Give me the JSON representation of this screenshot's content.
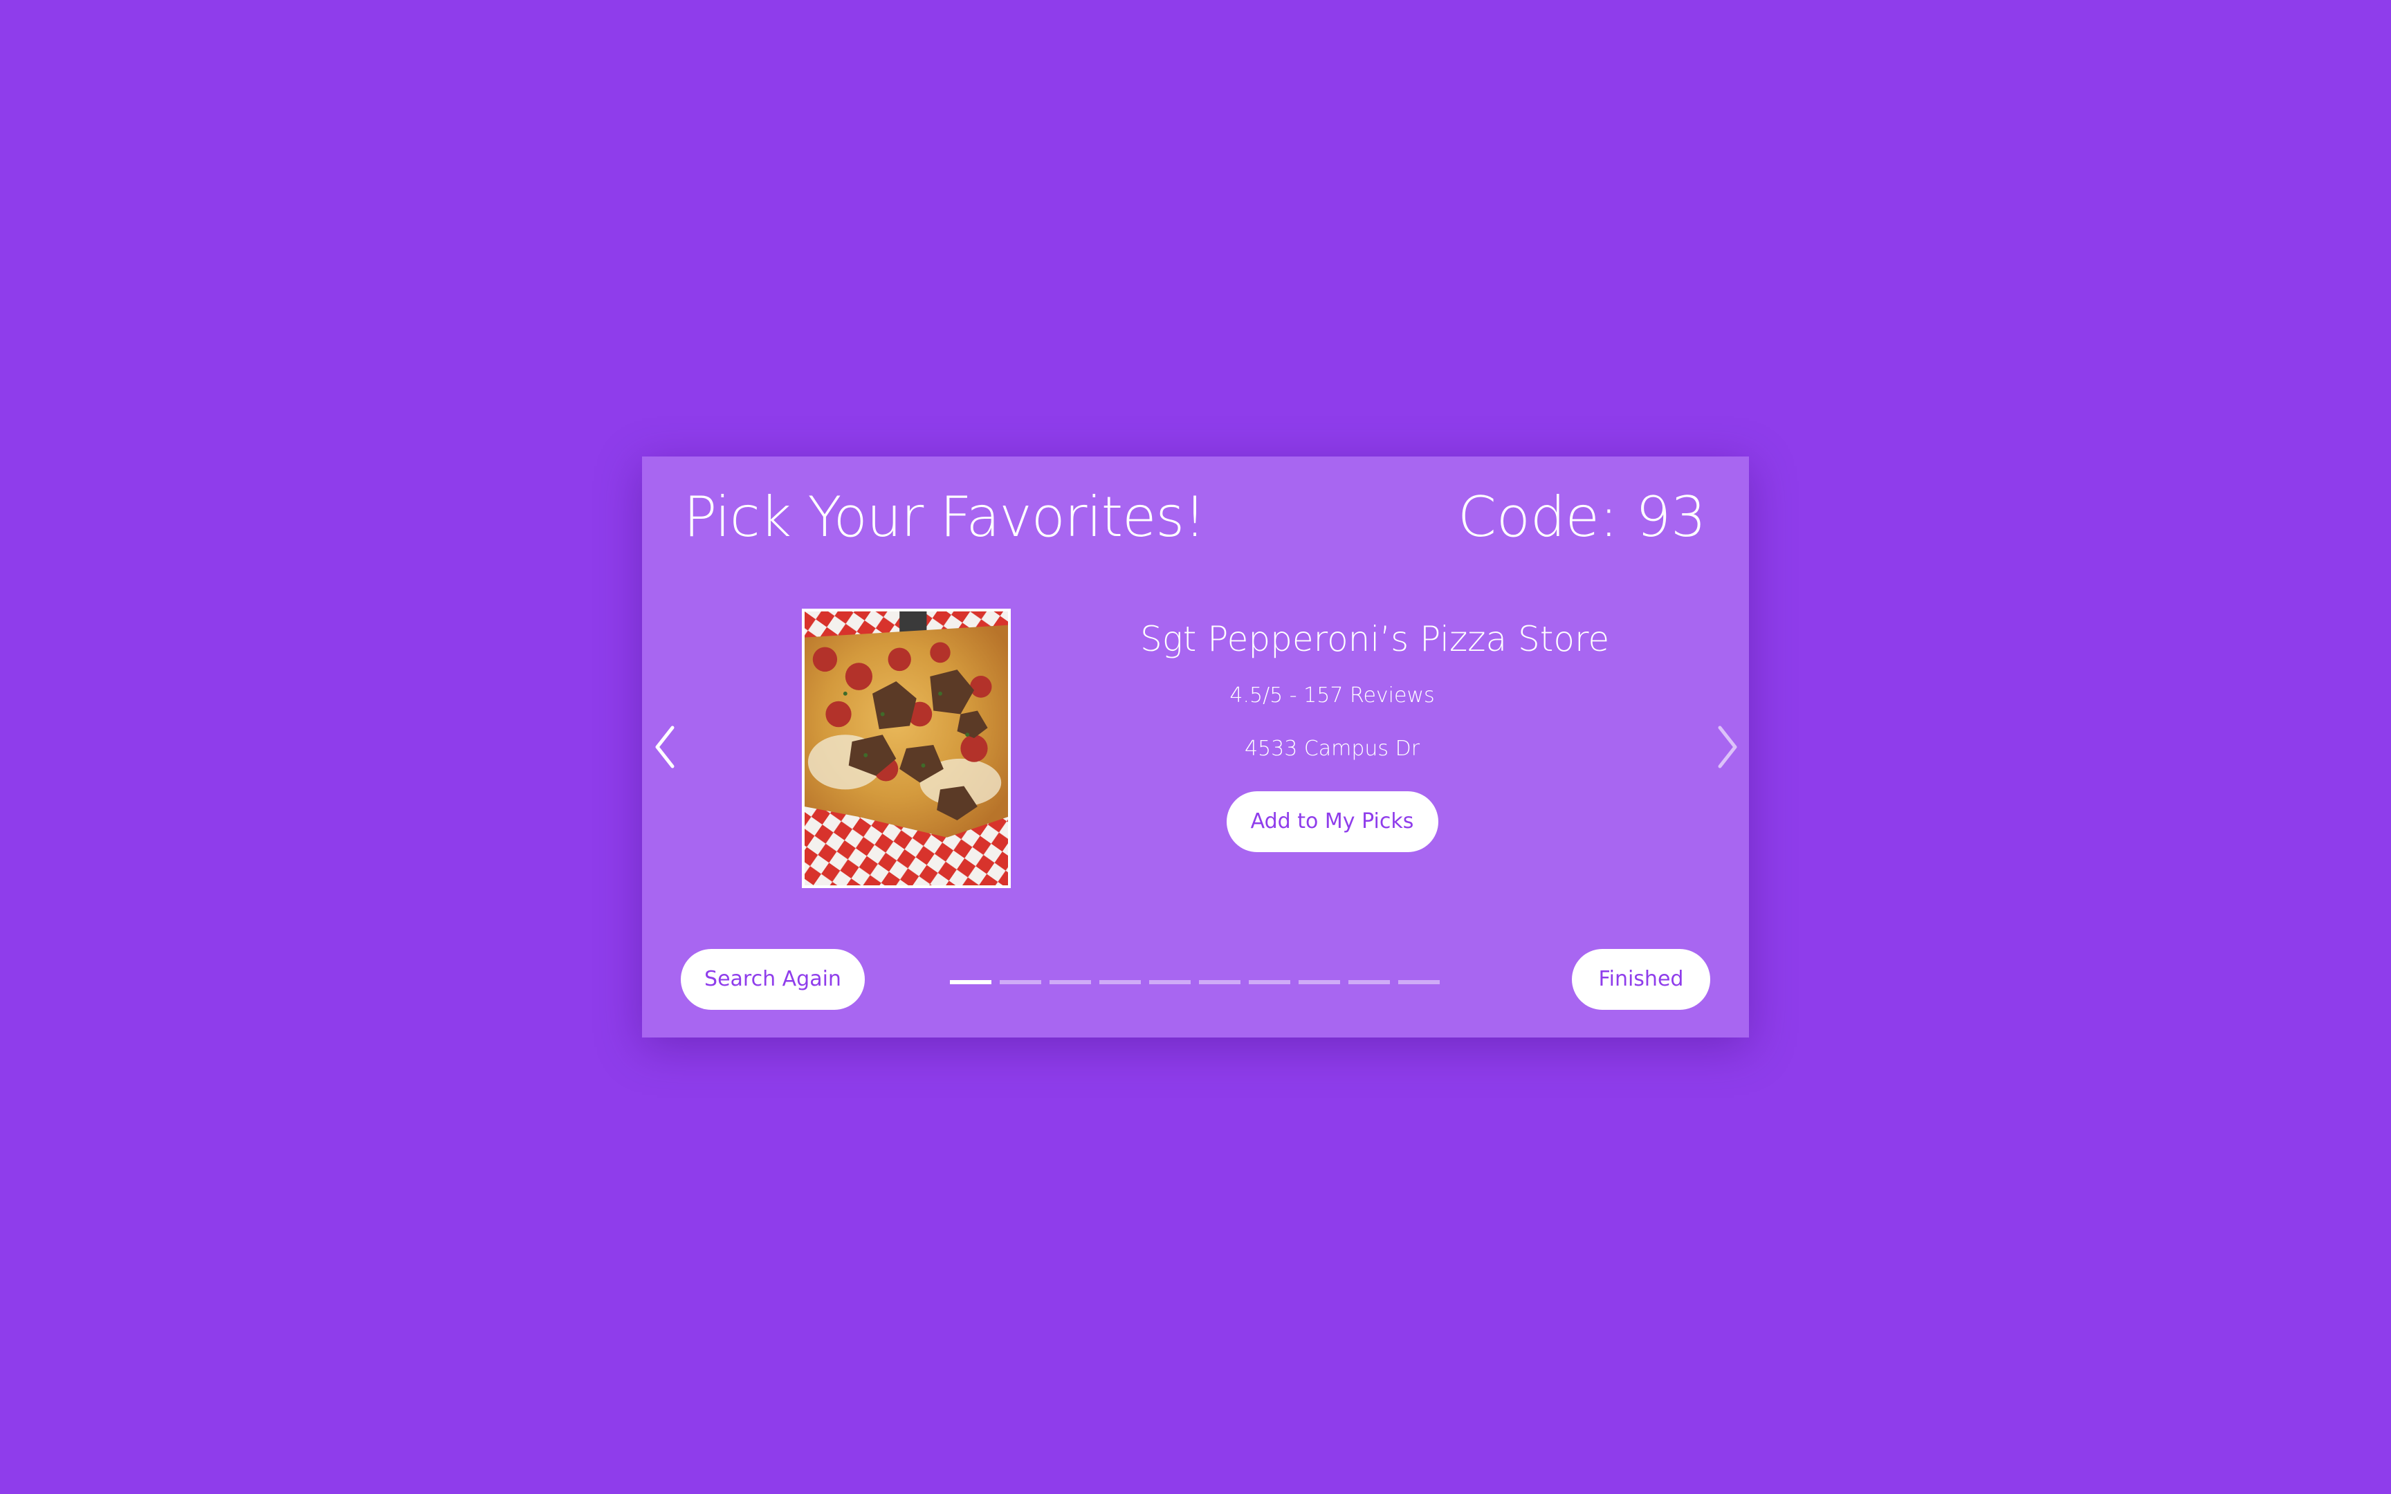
{
  "colors": {
    "page_background": "#8f3deb",
    "card_background": "#a866f1",
    "button_background": "#ffffff",
    "button_text": "#8f3deb",
    "text": "#ffffff"
  },
  "header": {
    "title": "Pick Your Favorites!",
    "code": "Code: 93"
  },
  "restaurant": {
    "name": "Sgt Pepperoni’s Pizza Store",
    "rating": "4.5/5 - 157 Reviews",
    "address": "4533 Campus Dr",
    "image_icon": "pizza-photo"
  },
  "actions": {
    "add_label": "Add to My Picks",
    "search_label": "Search Again",
    "finished_label": "Finished"
  },
  "carousel": {
    "prev_icon": "chevron-left-icon",
    "next_icon": "chevron-right-icon",
    "current_index": 1,
    "total": 10
  }
}
